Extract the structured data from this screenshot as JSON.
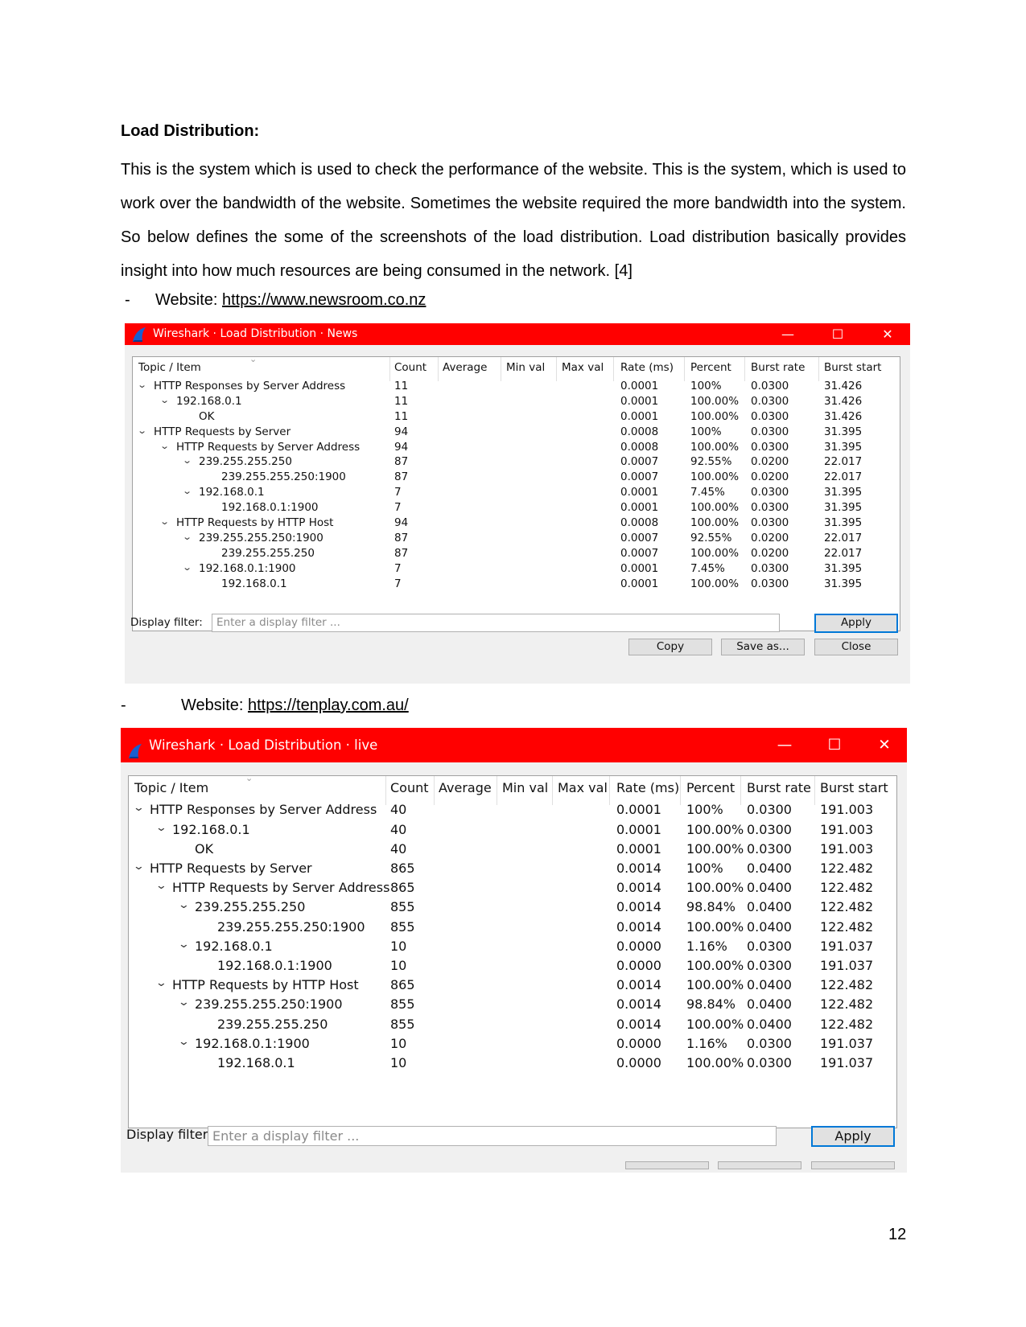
{
  "heading": "Load Distribution:",
  "paragraph": "This is the system which is used to check the performance of the website. This is the system, which is used to work over the bandwidth of the website. Sometimes the website required the more bandwidth into the system. So below defines the some of the screenshots of the load distribution. Load distribution basically provides insight into how much resources are being consumed in the network. [4]",
  "bullets": [
    {
      "dash": "-",
      "label": "Website: ",
      "link": "https://www.newsroom.co.nz"
    },
    {
      "dash": "-",
      "label": "Website: ",
      "link": "https://tenplay.com.au/"
    }
  ],
  "colors": {
    "titlebar": "#ff0000",
    "default_button_border": "#0078d7"
  },
  "columns": [
    "Topic / Item",
    "Count",
    "Average",
    "Min val",
    "Max val",
    "Rate (ms)",
    "Percent",
    "Burst rate",
    "Burst start"
  ],
  "windows": [
    {
      "title": "Wireshark · Load Distribution · News",
      "icon": "wireshark-fin-icon",
      "filter_label": "Display filter:",
      "filter_placeholder": "Enter a display filter ...",
      "apply_label": "Apply",
      "buttons": [
        "Copy",
        "Save as...",
        "Close"
      ],
      "rows": [
        {
          "level": 0,
          "expand": true,
          "topic": "HTTP Responses by Server Address",
          "count": "11",
          "rate": "0.0001",
          "percent": "100%",
          "burst_rate": "0.0300",
          "burst_start": "31.426"
        },
        {
          "level": 1,
          "expand": true,
          "topic": "192.168.0.1",
          "count": "11",
          "rate": "0.0001",
          "percent": "100.00%",
          "burst_rate": "0.0300",
          "burst_start": "31.426"
        },
        {
          "level": 2,
          "expand": false,
          "topic": "OK",
          "count": "11",
          "rate": "0.0001",
          "percent": "100.00%",
          "burst_rate": "0.0300",
          "burst_start": "31.426"
        },
        {
          "level": 0,
          "expand": true,
          "topic": "HTTP Requests by Server",
          "count": "94",
          "rate": "0.0008",
          "percent": "100%",
          "burst_rate": "0.0300",
          "burst_start": "31.395"
        },
        {
          "level": 1,
          "expand": true,
          "topic": "HTTP Requests by Server Address",
          "count": "94",
          "rate": "0.0008",
          "percent": "100.00%",
          "burst_rate": "0.0300",
          "burst_start": "31.395"
        },
        {
          "level": 2,
          "expand": true,
          "topic": "239.255.255.250",
          "count": "87",
          "rate": "0.0007",
          "percent": "92.55%",
          "burst_rate": "0.0200",
          "burst_start": "22.017"
        },
        {
          "level": 3,
          "expand": false,
          "topic": "239.255.255.250:1900",
          "count": "87",
          "rate": "0.0007",
          "percent": "100.00%",
          "burst_rate": "0.0200",
          "burst_start": "22.017"
        },
        {
          "level": 2,
          "expand": true,
          "topic": "192.168.0.1",
          "count": "7",
          "rate": "0.0001",
          "percent": "7.45%",
          "burst_rate": "0.0300",
          "burst_start": "31.395"
        },
        {
          "level": 3,
          "expand": false,
          "topic": "192.168.0.1:1900",
          "count": "7",
          "rate": "0.0001",
          "percent": "100.00%",
          "burst_rate": "0.0300",
          "burst_start": "31.395"
        },
        {
          "level": 1,
          "expand": true,
          "topic": "HTTP Requests by HTTP Host",
          "count": "94",
          "rate": "0.0008",
          "percent": "100.00%",
          "burst_rate": "0.0300",
          "burst_start": "31.395"
        },
        {
          "level": 2,
          "expand": true,
          "topic": "239.255.255.250:1900",
          "count": "87",
          "rate": "0.0007",
          "percent": "92.55%",
          "burst_rate": "0.0200",
          "burst_start": "22.017"
        },
        {
          "level": 3,
          "expand": false,
          "topic": "239.255.255.250",
          "count": "87",
          "rate": "0.0007",
          "percent": "100.00%",
          "burst_rate": "0.0200",
          "burst_start": "22.017"
        },
        {
          "level": 2,
          "expand": true,
          "topic": "192.168.0.1:1900",
          "count": "7",
          "rate": "0.0001",
          "percent": "7.45%",
          "burst_rate": "0.0300",
          "burst_start": "31.395"
        },
        {
          "level": 3,
          "expand": false,
          "topic": "192.168.0.1",
          "count": "7",
          "rate": "0.0001",
          "percent": "100.00%",
          "burst_rate": "0.0300",
          "burst_start": "31.395"
        }
      ]
    },
    {
      "title": "Wireshark · Load Distribution · live",
      "icon": "wireshark-fin-icon",
      "filter_label": "Display filter:",
      "filter_placeholder": "Enter a display filter ...",
      "apply_label": "Apply",
      "buttons": [],
      "rows": [
        {
          "level": 0,
          "expand": true,
          "topic": "HTTP Responses by Server Address",
          "count": "40",
          "rate": "0.0001",
          "percent": "100%",
          "burst_rate": "0.0300",
          "burst_start": "191.003"
        },
        {
          "level": 1,
          "expand": true,
          "topic": "192.168.0.1",
          "count": "40",
          "rate": "0.0001",
          "percent": "100.00%",
          "burst_rate": "0.0300",
          "burst_start": "191.003"
        },
        {
          "level": 2,
          "expand": false,
          "topic": "OK",
          "count": "40",
          "rate": "0.0001",
          "percent": "100.00%",
          "burst_rate": "0.0300",
          "burst_start": "191.003"
        },
        {
          "level": 0,
          "expand": true,
          "topic": "HTTP Requests by Server",
          "count": "865",
          "rate": "0.0014",
          "percent": "100%",
          "burst_rate": "0.0400",
          "burst_start": "122.482"
        },
        {
          "level": 1,
          "expand": true,
          "topic": "HTTP Requests by Server Address",
          "count": "865",
          "rate": "0.0014",
          "percent": "100.00%",
          "burst_rate": "0.0400",
          "burst_start": "122.482"
        },
        {
          "level": 2,
          "expand": true,
          "topic": "239.255.255.250",
          "count": "855",
          "rate": "0.0014",
          "percent": "98.84%",
          "burst_rate": "0.0400",
          "burst_start": "122.482"
        },
        {
          "level": 3,
          "expand": false,
          "topic": "239.255.255.250:1900",
          "count": "855",
          "rate": "0.0014",
          "percent": "100.00%",
          "burst_rate": "0.0400",
          "burst_start": "122.482"
        },
        {
          "level": 2,
          "expand": true,
          "topic": "192.168.0.1",
          "count": "10",
          "rate": "0.0000",
          "percent": "1.16%",
          "burst_rate": "0.0300",
          "burst_start": "191.037"
        },
        {
          "level": 3,
          "expand": false,
          "topic": "192.168.0.1:1900",
          "count": "10",
          "rate": "0.0000",
          "percent": "100.00%",
          "burst_rate": "0.0300",
          "burst_start": "191.037"
        },
        {
          "level": 1,
          "expand": true,
          "topic": "HTTP Requests by HTTP Host",
          "count": "865",
          "rate": "0.0014",
          "percent": "100.00%",
          "burst_rate": "0.0400",
          "burst_start": "122.482"
        },
        {
          "level": 2,
          "expand": true,
          "topic": "239.255.255.250:1900",
          "count": "855",
          "rate": "0.0014",
          "percent": "98.84%",
          "burst_rate": "0.0400",
          "burst_start": "122.482"
        },
        {
          "level": 3,
          "expand": false,
          "topic": "239.255.255.250",
          "count": "855",
          "rate": "0.0014",
          "percent": "100.00%",
          "burst_rate": "0.0400",
          "burst_start": "122.482"
        },
        {
          "level": 2,
          "expand": true,
          "topic": "192.168.0.1:1900",
          "count": "10",
          "rate": "0.0000",
          "percent": "1.16%",
          "burst_rate": "0.0300",
          "burst_start": "191.037"
        },
        {
          "level": 3,
          "expand": false,
          "topic": "192.168.0.1",
          "count": "10",
          "rate": "0.0000",
          "percent": "100.00%",
          "burst_rate": "0.0300",
          "burst_start": "191.037"
        }
      ]
    }
  ],
  "page_number": "12"
}
